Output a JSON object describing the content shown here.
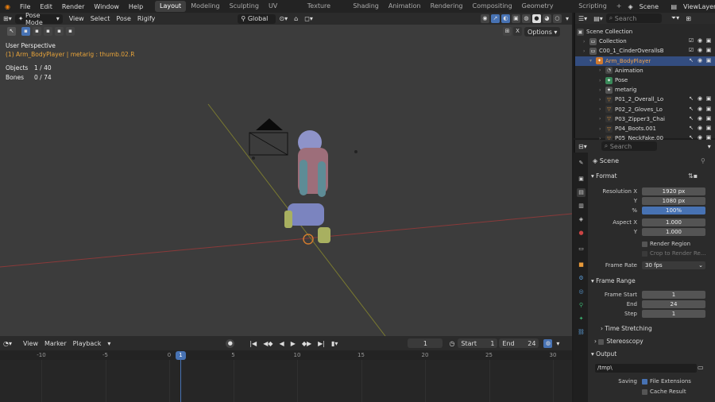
{
  "menu": [
    "File",
    "Edit",
    "Render",
    "Window",
    "Help"
  ],
  "workspaces": [
    "Layout",
    "Modeling",
    "Sculpting",
    "UV Editing",
    "Texture Paint",
    "Shading",
    "Animation",
    "Rendering",
    "Compositing",
    "Geometry Nodes",
    "Scripting"
  ],
  "active_workspace": "Layout",
  "scene_name": "Scene",
  "view_layer": "ViewLayer",
  "viewport_header": {
    "mode": "Pose Mode",
    "menus": [
      "View",
      "Select",
      "Pose",
      "Rigify"
    ],
    "transform": "Global",
    "options": "Options"
  },
  "overlay": {
    "perspective": "User Perspective",
    "active": "(1) Arm_BodyPlayer | metarig : thumb.02.R",
    "objects_label": "Objects",
    "objects_value": "1 / 40",
    "bones_label": "Bones",
    "bones_value": "0 / 74"
  },
  "timeline": {
    "menus": [
      "View",
      "Marker",
      "Playback"
    ],
    "current_frame": "1",
    "start_label": "Start",
    "start": "1",
    "end_label": "End",
    "end": "24",
    "ruler": [
      "-10",
      "-5",
      "0",
      "5",
      "10",
      "15",
      "20",
      "25",
      "30"
    ],
    "playhead": "1"
  },
  "outliner": {
    "search": "Search",
    "rows": [
      {
        "label": "Scene Collection",
        "kind": "scene"
      },
      {
        "label": "Collection",
        "kind": "col"
      },
      {
        "label": "C00_1_CinderOverallsBo",
        "kind": "col"
      },
      {
        "label": "Arm_BodyPlayer",
        "kind": "arm",
        "sel": true
      },
      {
        "label": "Animation",
        "kind": "anim"
      },
      {
        "label": "Pose",
        "kind": "pose"
      },
      {
        "label": "metarig",
        "kind": "arm2"
      },
      {
        "label": "P01_2_Overall_Lo",
        "kind": "mesh"
      },
      {
        "label": "P02_2_Gloves_Lo",
        "kind": "mesh"
      },
      {
        "label": "P03_Zipper3_Chai",
        "kind": "mesh"
      },
      {
        "label": "P04_Boots.001",
        "kind": "mesh"
      },
      {
        "label": "P05_NeckFake.00",
        "kind": "mesh"
      }
    ]
  },
  "properties": {
    "search": "Search",
    "title": "Scene",
    "format": {
      "header": "Format",
      "res_x_label": "Resolution X",
      "res_x": "1920 px",
      "res_y_label": "Y",
      "res_y": "1080 px",
      "pct_label": "%",
      "pct": "100%",
      "asp_x_label": "Aspect X",
      "asp_x": "1.000",
      "asp_y_label": "Y",
      "asp_y": "1.000",
      "render_region": "Render Region",
      "crop": "Crop to Render Re...",
      "fps_label": "Frame Rate",
      "fps": "30 fps"
    },
    "frame_range": {
      "header": "Frame Range",
      "start_label": "Frame Start",
      "start": "1",
      "end_label": "End",
      "end": "24",
      "step_label": "Step",
      "step": "1"
    },
    "time_stretching": "Time Stretching",
    "stereoscopy": "Stereoscopy",
    "output": {
      "header": "Output",
      "path": "/tmp\\",
      "saving_label": "Saving",
      "file_ext": "File Extensions",
      "cache": "Cache Result"
    }
  }
}
